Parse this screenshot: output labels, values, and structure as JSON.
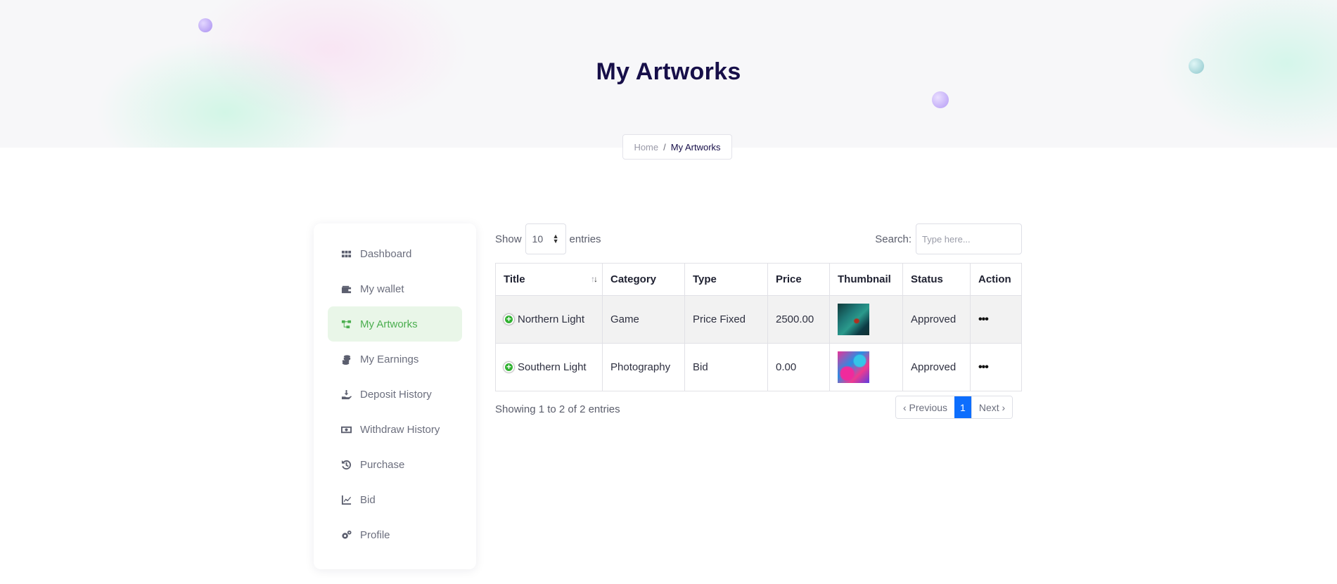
{
  "hero": {
    "title": "My Artworks"
  },
  "breadcrumb": {
    "home": "Home",
    "separator": "/",
    "current": "My Artworks"
  },
  "sidebar": {
    "items": [
      {
        "label": "Dashboard",
        "icon": "grid-icon"
      },
      {
        "label": "My wallet",
        "icon": "wallet-icon"
      },
      {
        "label": "My Artworks",
        "icon": "artworks-icon",
        "active": true
      },
      {
        "label": "My Earnings",
        "icon": "coins-icon"
      },
      {
        "label": "Deposit History",
        "icon": "deposit-icon"
      },
      {
        "label": "Withdraw History",
        "icon": "money-icon"
      },
      {
        "label": "Purchase",
        "icon": "history-icon"
      },
      {
        "label": "Bid",
        "icon": "chart-line-icon"
      },
      {
        "label": "Profile",
        "icon": "gears-icon"
      }
    ]
  },
  "table_controls": {
    "show_label": "Show",
    "entries_value": "10",
    "entries_label": "entries",
    "search_label": "Search:",
    "search_placeholder": "Type here..."
  },
  "table": {
    "columns": [
      "Title",
      "Category",
      "Type",
      "Price",
      "Thumbnail",
      "Status",
      "Action"
    ],
    "rows": [
      {
        "title": "Northern Light",
        "category": "Game",
        "type": "Price Fixed",
        "price": "2500.00",
        "status": "Approved",
        "action": "•••"
      },
      {
        "title": "Southern Light",
        "category": "Photography",
        "type": "Bid",
        "price": "0.00",
        "status": "Approved",
        "action": "•••"
      }
    ]
  },
  "footer": {
    "info": "Showing 1 to 2 of 2 entries",
    "previous": "‹ Previous",
    "current_page": "1",
    "next": "Next ›"
  },
  "colors": {
    "accent_active": "#4bae4f",
    "active_bg": "#e9f6e8",
    "page_button": "#0d6efd",
    "title": "#170f49"
  }
}
